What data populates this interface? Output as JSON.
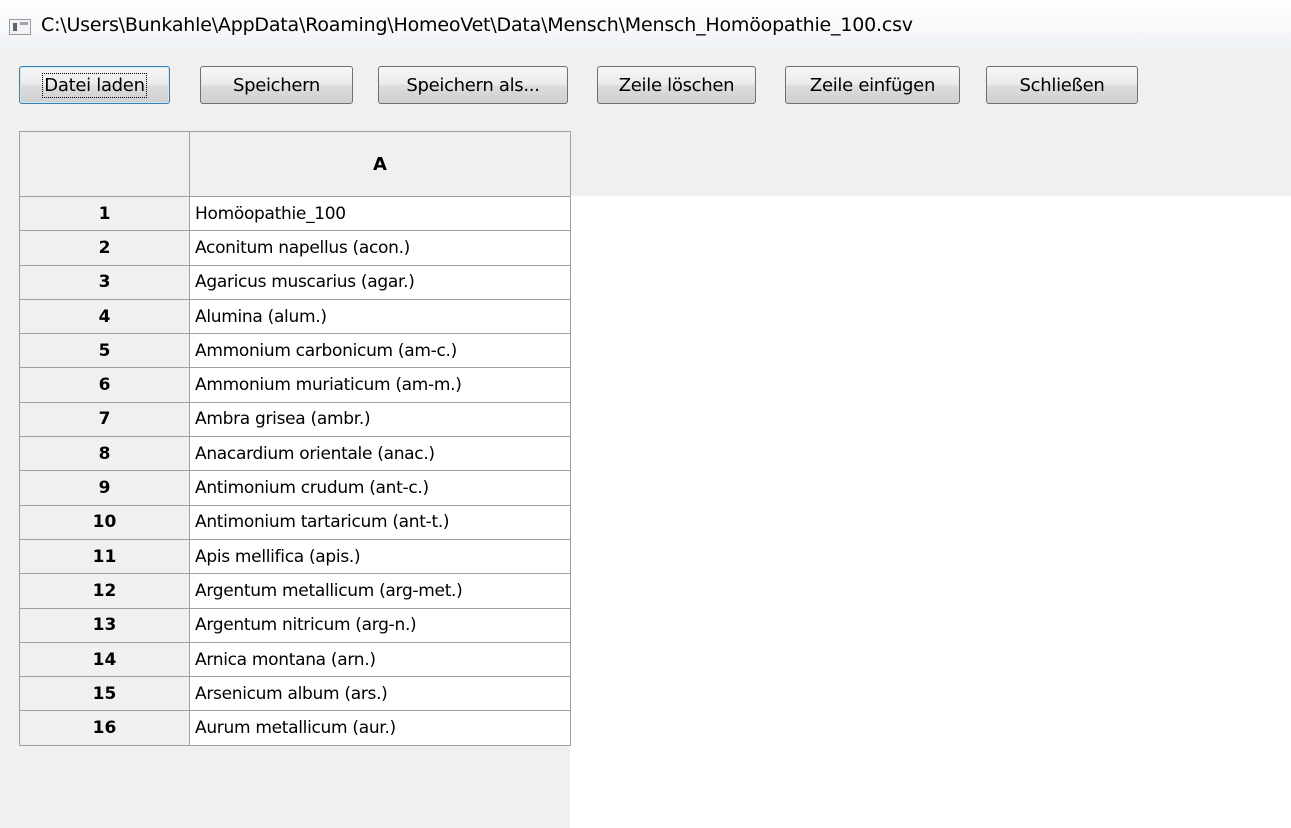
{
  "window": {
    "title": "C:\\Users\\Bunkahle\\AppData\\Roaming\\HomeoVet\\Data\\Mensch\\Mensch_Homöopathie_100.csv"
  },
  "toolbar": {
    "load_label": "Datei laden",
    "save_label": "Speichern",
    "save_as_label": "Speichern als...",
    "delete_row_label": "Zeile löschen",
    "insert_row_label": "Zeile einfügen",
    "close_label": "Schließen"
  },
  "table": {
    "column_headers": [
      "A"
    ],
    "rows": [
      {
        "num": "1",
        "a": "Homöopathie_100"
      },
      {
        "num": "2",
        "a": "Aconitum napellus (acon.)"
      },
      {
        "num": "3",
        "a": "Agaricus muscarius (agar.)"
      },
      {
        "num": "4",
        "a": "Alumina (alum.)"
      },
      {
        "num": "5",
        "a": "Ammonium carbonicum (am-c.)"
      },
      {
        "num": "6",
        "a": "Ammonium muriaticum (am-m.)"
      },
      {
        "num": "7",
        "a": "Ambra grisea (ambr.)"
      },
      {
        "num": "8",
        "a": "Anacardium orientale (anac.)"
      },
      {
        "num": "9",
        "a": "Antimonium crudum (ant-c.)"
      },
      {
        "num": "10",
        "a": "Antimonium tartaricum (ant-t.)"
      },
      {
        "num": "11",
        "a": "Apis mellifica (apis.)"
      },
      {
        "num": "12",
        "a": "Argentum metallicum (arg-met.)"
      },
      {
        "num": "13",
        "a": "Argentum nitricum (arg-n.)"
      },
      {
        "num": "14",
        "a": "Arnica montana (arn.)"
      },
      {
        "num": "15",
        "a": "Arsenicum album (ars.)"
      },
      {
        "num": "16",
        "a": "Aurum metallicum (aur.)"
      }
    ]
  }
}
